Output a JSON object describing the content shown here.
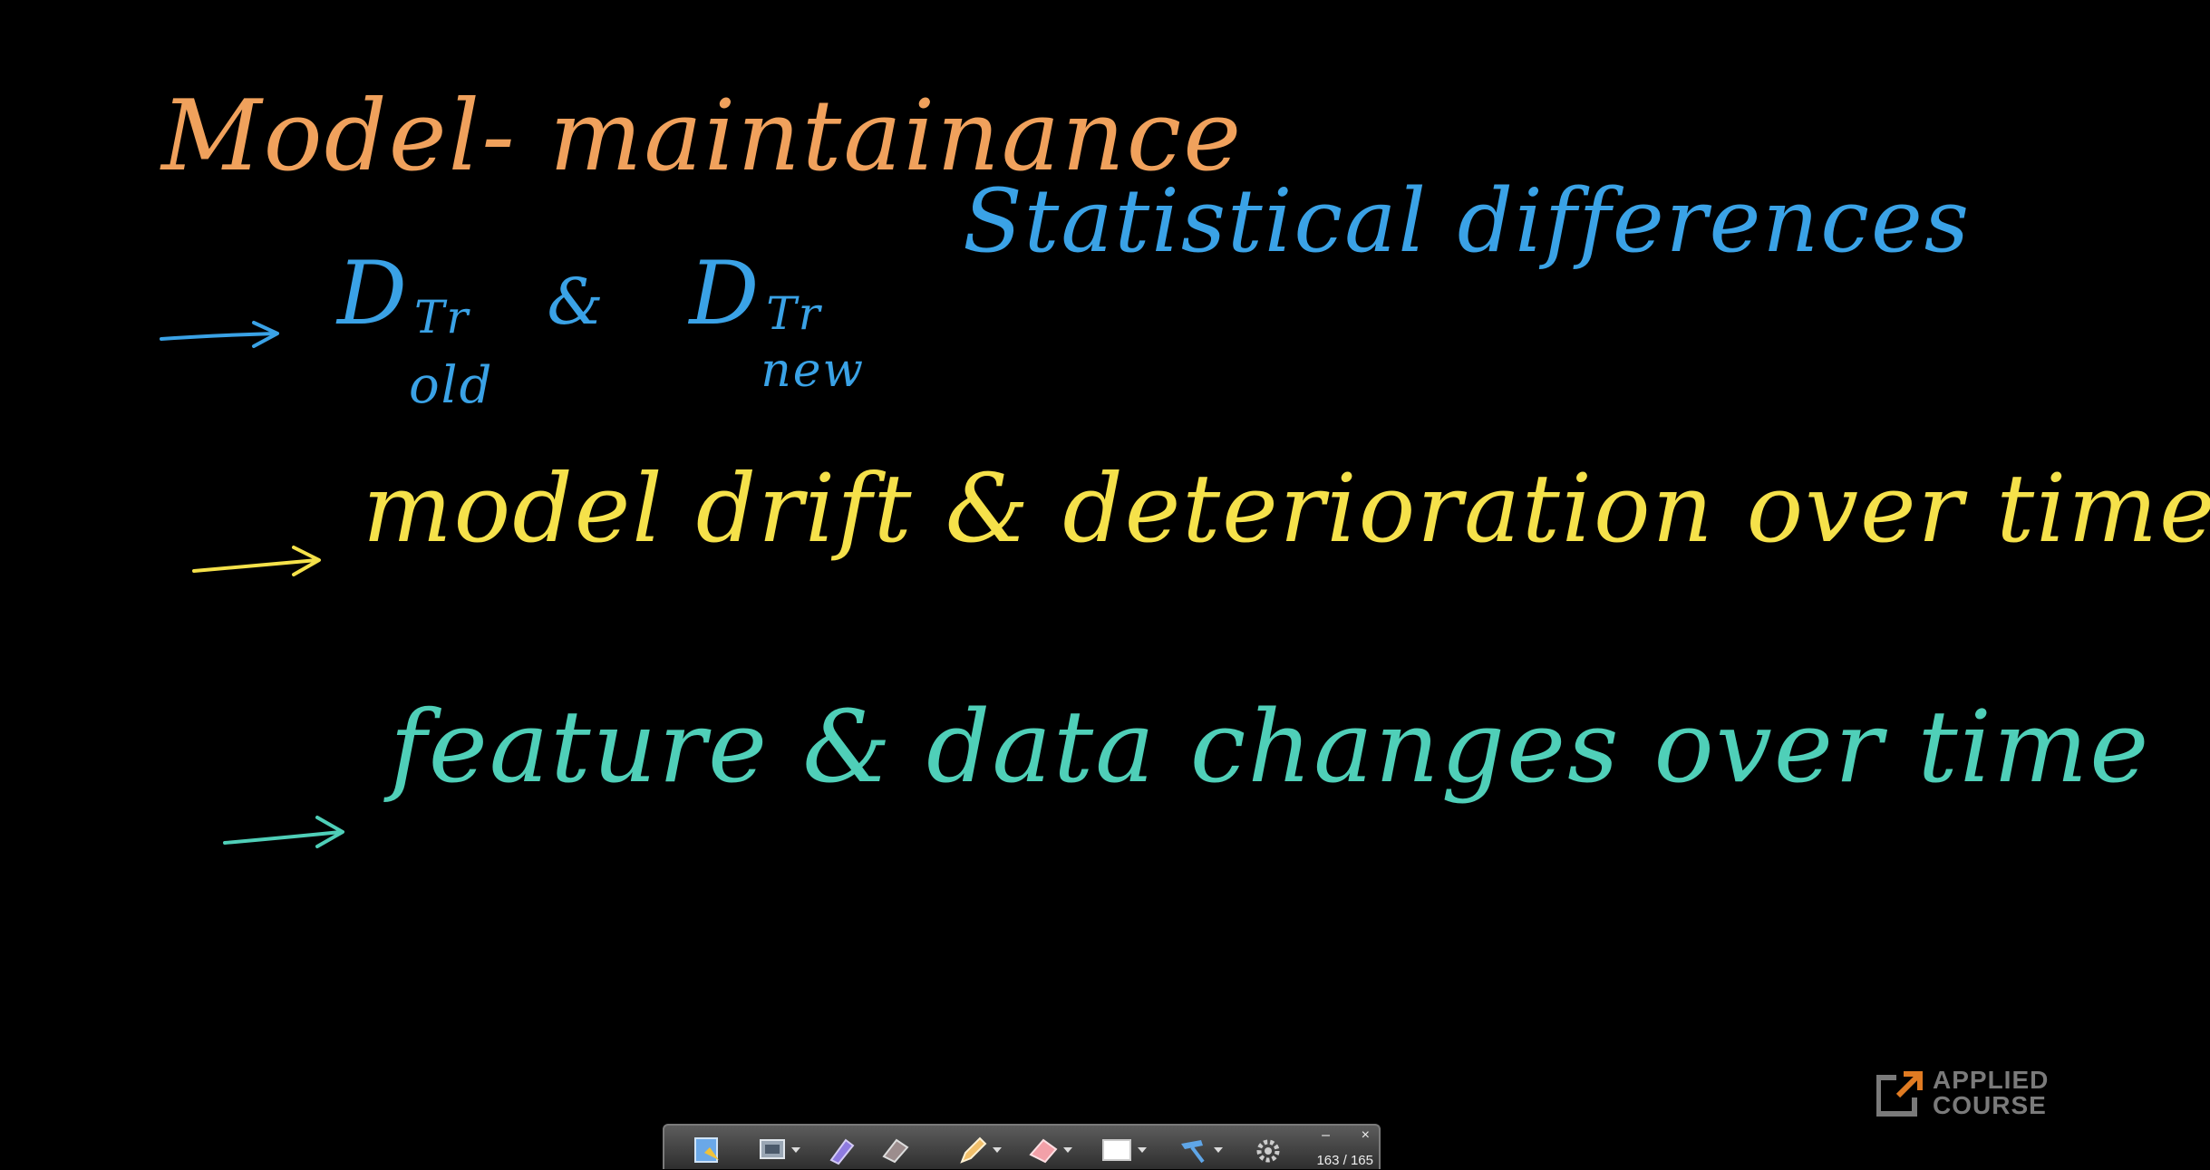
{
  "board": {
    "title": "Model- maintainance",
    "line1": {
      "d_old_base": "D",
      "d_old_sup": "Tr",
      "d_old_sub": "old",
      "amp": "&",
      "d_new_base": "D",
      "d_new_sup": "Tr",
      "d_new_sub": "new",
      "statistical": "Statistical differences"
    },
    "line2": "model drift & deterioration over time",
    "line3": "feature & data changes over time"
  },
  "colors": {
    "title": "#f0a15c",
    "line1": "#3aa2e6",
    "line2": "#f5e14a",
    "line3": "#4fcfb8"
  },
  "logo": {
    "line1": "APPLIED",
    "line2": "COURSE"
  },
  "toolbar": {
    "icons": [
      "bookmark-icon",
      "screen-capture-icon",
      "highlighter-icon",
      "eraser-icon",
      "pen-icon",
      "shape-eraser-icon",
      "whiteboard-icon",
      "tools-icon",
      "settings-icon"
    ],
    "page_counter": "163 / 165",
    "minimize": "–",
    "close": "×"
  }
}
